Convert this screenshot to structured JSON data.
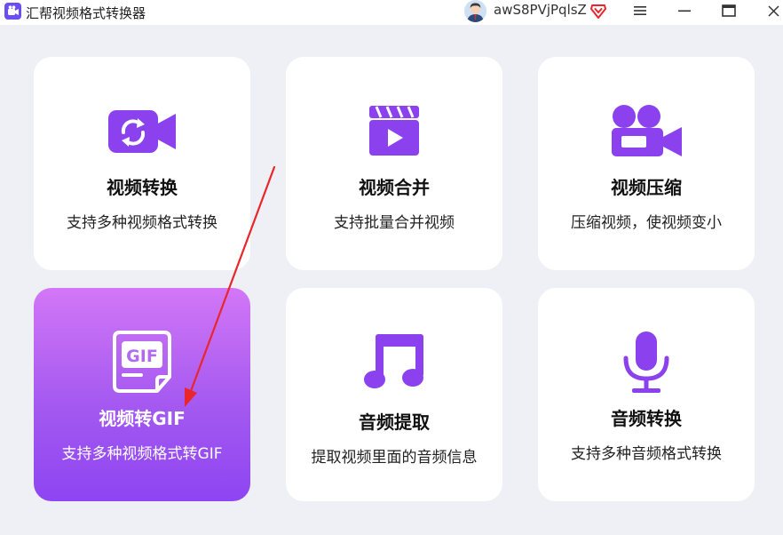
{
  "app": {
    "title": "汇帮视频格式转换器",
    "username": "awS8PVjPqlsZ"
  },
  "colors": {
    "accent": "#8e45f2",
    "icon_purple": "#8b42ee",
    "arrow_red": "#e8262b"
  },
  "cards": [
    {
      "title": "视频转换",
      "desc": "支持多种视频格式转换",
      "icon": "video-convert-icon"
    },
    {
      "title": "视频合并",
      "desc": "支持批量合并视频",
      "icon": "clapperboard-icon"
    },
    {
      "title": "视频压缩",
      "desc": "压缩视频，使视频变小",
      "icon": "video-camera-icon"
    },
    {
      "title": "视频转GIF",
      "desc": "支持多种视频格式转GIF",
      "icon": "gif-file-icon"
    },
    {
      "title": "音频提取",
      "desc": "提取视频里面的音频信息",
      "icon": "music-note-icon"
    },
    {
      "title": "音频转换",
      "desc": "支持多种音频格式转换",
      "icon": "microphone-icon"
    }
  ]
}
